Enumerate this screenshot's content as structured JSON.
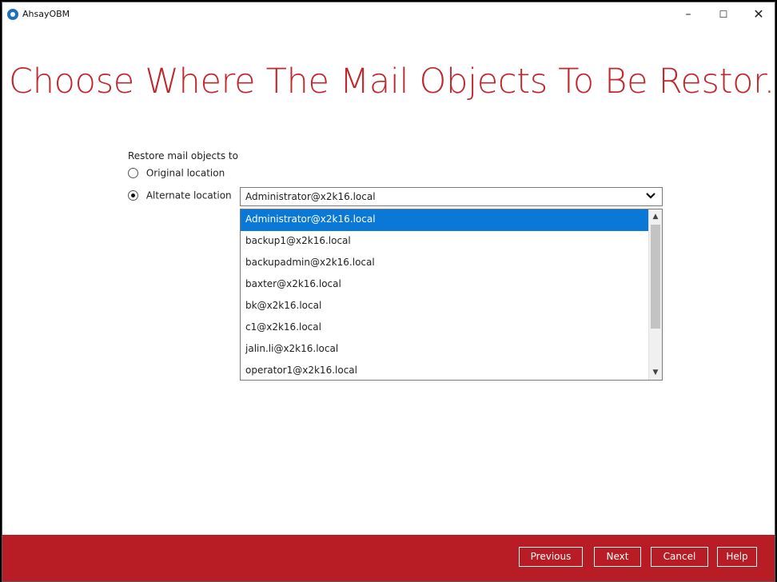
{
  "window": {
    "title": "AhsayOBM",
    "minimize_label": "–",
    "maximize_label": "☐",
    "close_label": "✕"
  },
  "page": {
    "title": "Choose Where The Mail Objects To Be Restor..."
  },
  "restore": {
    "label": "Restore mail objects to",
    "original_option": "Original location",
    "alternate_option": "Alternate location",
    "selected_option": "alternate",
    "select_value": "Administrator@x2k16.local",
    "options": [
      "Administrator@x2k16.local",
      "backup1@x2k16.local",
      "backupadmin@x2k16.local",
      "baxter@x2k16.local",
      "bk@x2k16.local",
      "c1@x2k16.local",
      "jalin.li@x2k16.local",
      "operator1@x2k16.local"
    ]
  },
  "footer": {
    "previous": "Previous",
    "next": "Next",
    "cancel": "Cancel",
    "help": "Help"
  },
  "colors": {
    "accent": "#c1272d",
    "footer": "#b81c24",
    "selection": "#0a78d7"
  }
}
